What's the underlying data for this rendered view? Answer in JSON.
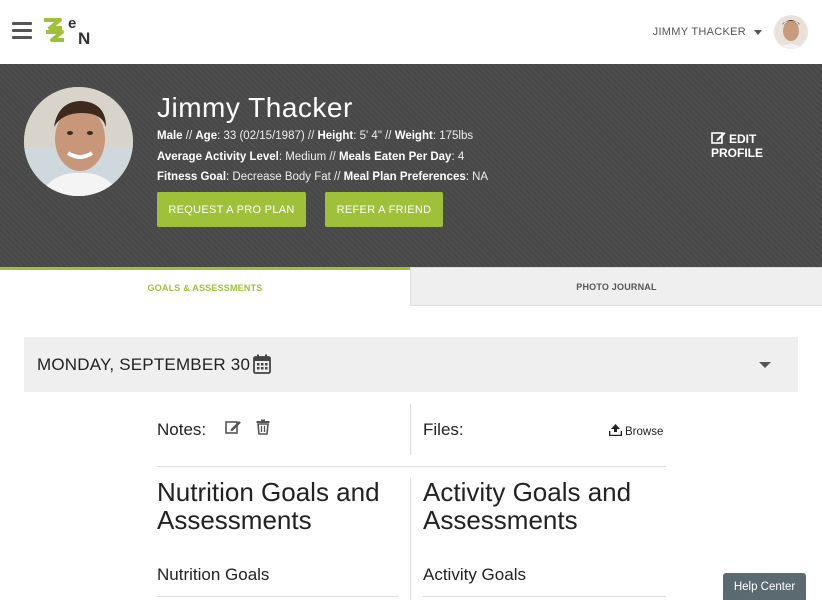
{
  "header": {
    "user_name": "JIMMY THACKER"
  },
  "profile": {
    "name": "Jimmy Thacker",
    "gender": "Male",
    "age_label": "Age",
    "age_value": ": 33 (02/15/1987) // ",
    "height_label": "Height",
    "height_value": ": 5' 4\" // ",
    "weight_label": "Weight",
    "weight_value": ": 175lbs",
    "activity_label": "Average Activity Level",
    "activity_value": ": Medium // ",
    "meals_label": "Meals Eaten Per Day",
    "meals_value": ": 4",
    "fitness_label": "Fitness Goal",
    "fitness_value": ": Decrease Body Fat // ",
    "meal_plan_label": "Meal Plan Preferences",
    "meal_plan_value": ": NA",
    "request_pro_label": "REQUEST A PRO PLAN",
    "refer_label": "REFER A FRIEND",
    "edit_line1": "EDIT",
    "edit_line2": "PROFILE"
  },
  "tabs": [
    {
      "label": "GOALS & ASSESSMENTS",
      "active": true
    },
    {
      "label": "PHOTO JOURNAL",
      "active": false
    }
  ],
  "date_bar": {
    "date": "MONDAY, SEPTEMBER 30"
  },
  "notes": {
    "label": "Notes:"
  },
  "files": {
    "label": "Files:",
    "browse_label": "Browse"
  },
  "nutrition": {
    "heading": "Nutrition Goals and Assessments",
    "subheading": "Nutrition Goals"
  },
  "activity": {
    "heading": "Activity Goals and Assessments",
    "subheading": "Activity Goals"
  },
  "help_center_label": "Help Center",
  "colors": {
    "accent": "#9fc13a",
    "banner": "#4a4a4a",
    "help": "#5a6a70"
  }
}
